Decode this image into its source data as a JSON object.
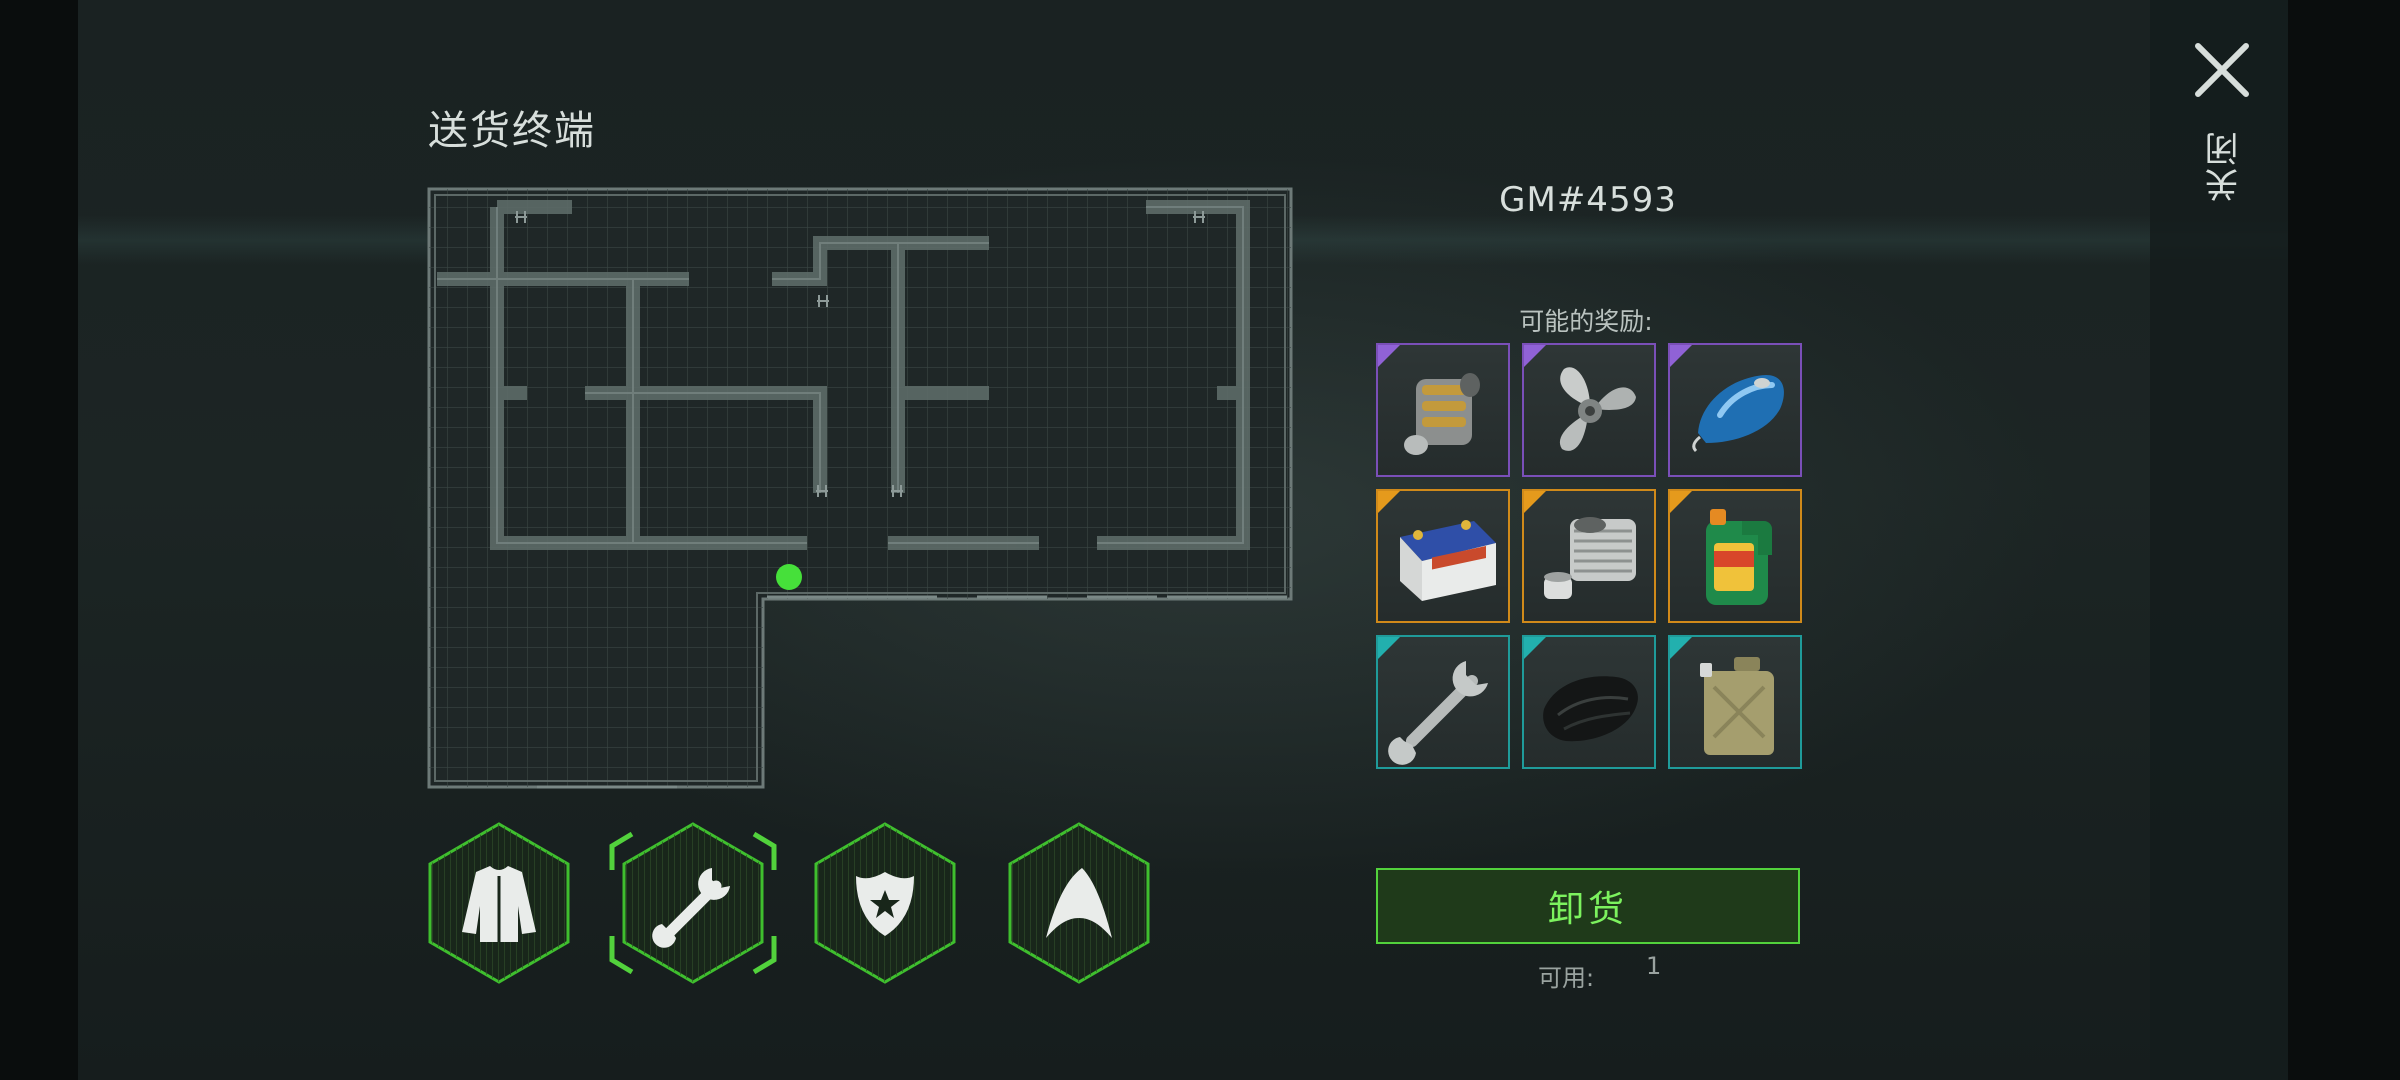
{
  "header": {
    "title": "送货终端"
  },
  "order": {
    "id": "GM#4593"
  },
  "rewards": {
    "label": "可能的奖励:",
    "items": [
      {
        "name": "camshaft",
        "rarity": "epic"
      },
      {
        "name": "propeller",
        "rarity": "epic"
      },
      {
        "name": "fuel-tank",
        "rarity": "epic"
      },
      {
        "name": "car-battery",
        "rarity": "rare"
      },
      {
        "name": "engine-cylinder",
        "rarity": "rare"
      },
      {
        "name": "motor-oil",
        "rarity": "rare"
      },
      {
        "name": "wrench",
        "rarity": "uncommon"
      },
      {
        "name": "rag",
        "rarity": "uncommon"
      },
      {
        "name": "jerrycan",
        "rarity": "uncommon"
      }
    ]
  },
  "categories": [
    {
      "icon": "jacket-icon",
      "selected": false
    },
    {
      "icon": "wrench-icon",
      "selected": true
    },
    {
      "icon": "police-badge-icon",
      "selected": false
    },
    {
      "icon": "shark-fin-icon",
      "selected": false
    }
  ],
  "actions": {
    "unload_label": "卸货",
    "available_label": "可用:",
    "available_count": "1"
  },
  "close": {
    "label": "关闭"
  },
  "colors": {
    "accent_green": "#52d23c",
    "epic": "#7a4fb8",
    "rare": "#d08a1a",
    "uncommon": "#1f9b9a",
    "marker": "#46e03a"
  }
}
